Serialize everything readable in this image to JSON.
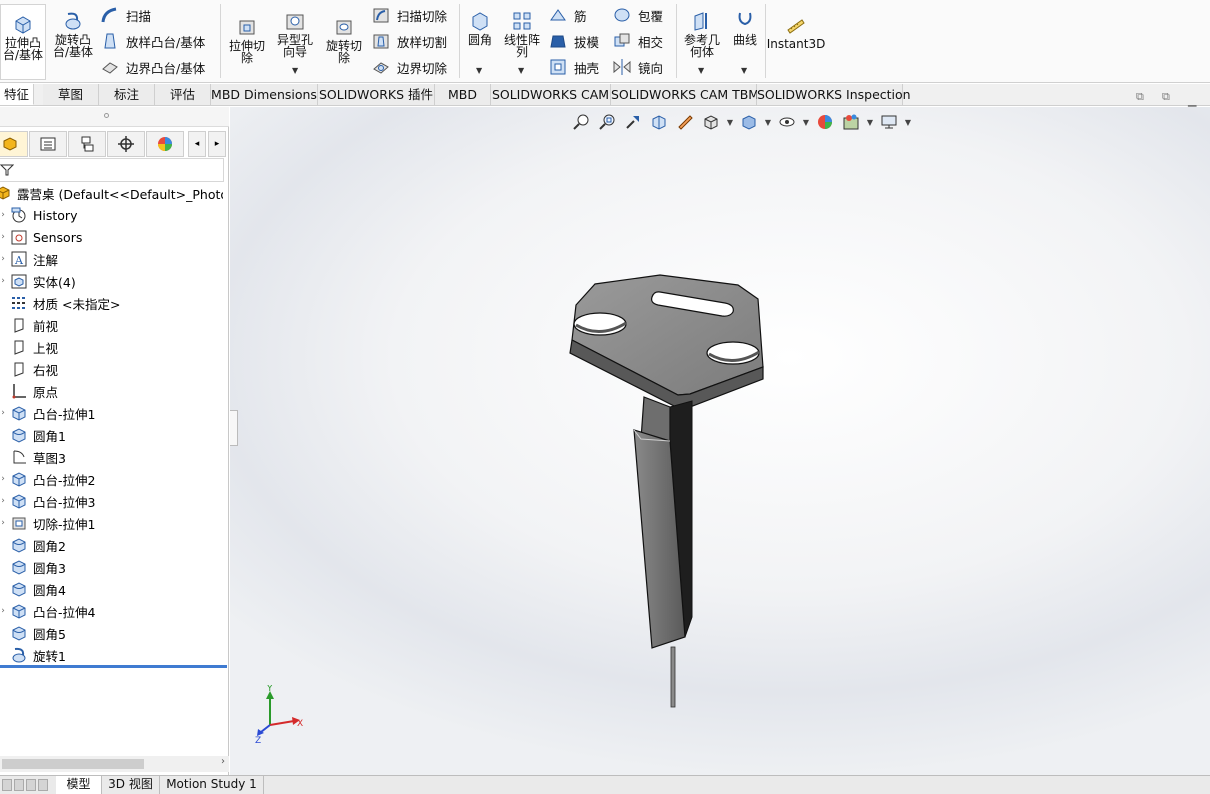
{
  "ribbon": {
    "extrude_boss": "拉伸凸\n台/基体",
    "revolve_boss": "旋转凸\n台/基体",
    "sweep": "扫描",
    "loft_boss": "放样凸台/基体",
    "boundary_boss": "边界凸台/基体",
    "extrude_cut": "拉伸切\n除",
    "hole_wizard": "异型孔\n向导",
    "revolve_cut": "旋转切\n除",
    "swept_cut": "扫描切除",
    "lofted_cut": "放样切割",
    "boundary_cut": "边界切除",
    "fillet": "圆角",
    "linear_pattern": "线性阵\n列",
    "rib": "筋",
    "draft": "拔模",
    "shell": "抽壳",
    "wrap": "包覆",
    "intersect": "相交",
    "mirror": "镜向",
    "ref_geometry": "参考几\n何体",
    "curves": "曲线",
    "instant3d": "Instant3D"
  },
  "tabs": [
    "特征",
    "草图",
    "标注",
    "评估",
    "MBD Dimensions",
    "SOLIDWORKS 插件",
    "MBD",
    "SOLIDWORKS CAM",
    "SOLIDWORKS CAM TBM",
    "SOLIDWORKS Inspection"
  ],
  "tree": {
    "root": "露营桌  (Default<<Default>_PhotoWo",
    "items": [
      {
        "label": "History",
        "icon": "history-icon"
      },
      {
        "label": "Sensors",
        "icon": "sensors-icon"
      },
      {
        "label": "注解",
        "icon": "annotations-icon"
      },
      {
        "label": "实体(4)",
        "icon": "solid-bodies-icon"
      },
      {
        "label": "材质 <未指定>",
        "icon": "material-icon"
      },
      {
        "label": "前视",
        "icon": "plane-icon"
      },
      {
        "label": "上视",
        "icon": "plane-icon"
      },
      {
        "label": "右视",
        "icon": "plane-icon"
      },
      {
        "label": "原点",
        "icon": "origin-icon"
      },
      {
        "label": "凸台-拉伸1",
        "icon": "extrude-icon"
      },
      {
        "label": "圆角1",
        "icon": "fillet-icon"
      },
      {
        "label": "草图3",
        "icon": "sketch-icon"
      },
      {
        "label": "凸台-拉伸2",
        "icon": "extrude-icon"
      },
      {
        "label": "凸台-拉伸3",
        "icon": "extrude-icon"
      },
      {
        "label": "切除-拉伸1",
        "icon": "cut-extrude-icon"
      },
      {
        "label": "圆角2",
        "icon": "fillet-icon"
      },
      {
        "label": "圆角3",
        "icon": "fillet-icon"
      },
      {
        "label": "圆角4",
        "icon": "fillet-icon"
      },
      {
        "label": "凸台-拉伸4",
        "icon": "extrude-icon"
      },
      {
        "label": "圆角5",
        "icon": "fillet-icon"
      },
      {
        "label": "旋转1",
        "icon": "revolve-icon"
      }
    ]
  },
  "bottom_tabs": [
    "模型",
    "3D 视图",
    "Motion Study 1"
  ],
  "triad": {
    "x": "X",
    "y": "Y",
    "z": "Z"
  },
  "colors": {
    "accent": "#3f7bd1",
    "part": "#7a7a7a"
  }
}
